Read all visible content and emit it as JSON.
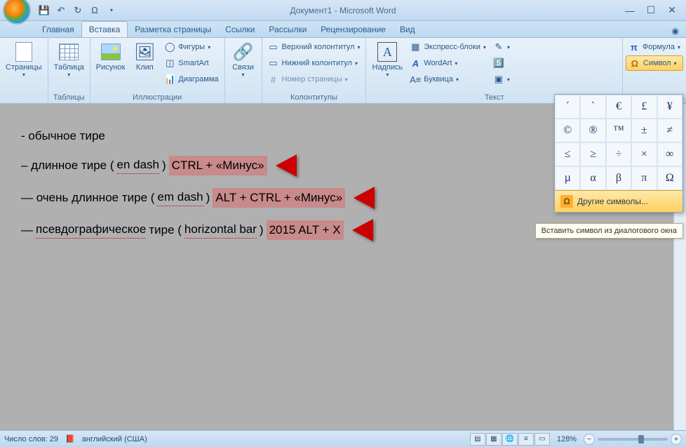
{
  "title": "Документ1 - Microsoft Word",
  "qat": {
    "save": "💾",
    "undo": "↶",
    "redo": "↻",
    "omega": "Ω"
  },
  "tabs": [
    "Главная",
    "Вставка",
    "Разметка страницы",
    "Ссылки",
    "Рассылки",
    "Рецензирование",
    "Вид"
  ],
  "active_tab": 1,
  "ribbon": {
    "pages_label": "Страницы",
    "tables": {
      "btn": "Таблица",
      "group": "Таблицы"
    },
    "illus": {
      "pic": "Рисунок",
      "clip": "Клип",
      "shapes": "Фигуры",
      "smartart": "SmartArt",
      "chart": "Диаграмма",
      "group": "Иллюстрации"
    },
    "links": {
      "btn": "Связи"
    },
    "headers": {
      "hdr": "Верхний колонтитул",
      "ftr": "Нижний колонтитул",
      "pg": "Номер страницы",
      "group": "Колонтитулы"
    },
    "text": {
      "textbox": "Надпись",
      "quick": "Экспресс-блоки",
      "wordart": "WordArt",
      "dropcap": "Буквица",
      "group": "Текст"
    },
    "symbols": {
      "formula": "Формула",
      "symbol": "Символ"
    }
  },
  "sym_grid": [
    "´",
    "`",
    "€",
    "£",
    "¥",
    "©",
    "®",
    "™",
    "±",
    "≠",
    "≤",
    "≥",
    "÷",
    "×",
    "∞",
    "µ",
    "α",
    "β",
    "π",
    "Ω"
  ],
  "sym_more": "Другие символы...",
  "tooltip": "Вставить символ из диалогового окна",
  "doc": {
    "l1": "- обычное тире",
    "l2a": "– длинное тире (",
    "l2b": "en dash",
    "l2c": ")",
    "l2hl": "CTRL + «Минус»",
    "l3a": "— очень длинное тире (",
    "l3b": "em dash",
    "l3c": ")",
    "l3hl": "ALT + CTRL + «Минус»",
    "l4a": "— ",
    "l4b": "псевдографическое",
    "l4c": " тире (",
    "l4d": "horizontal bar",
    "l4e": ")",
    "l4hl": "2015 ALT + X"
  },
  "status": {
    "words": "Число слов: 29",
    "lang": "английский (США)",
    "zoom": "128%"
  }
}
